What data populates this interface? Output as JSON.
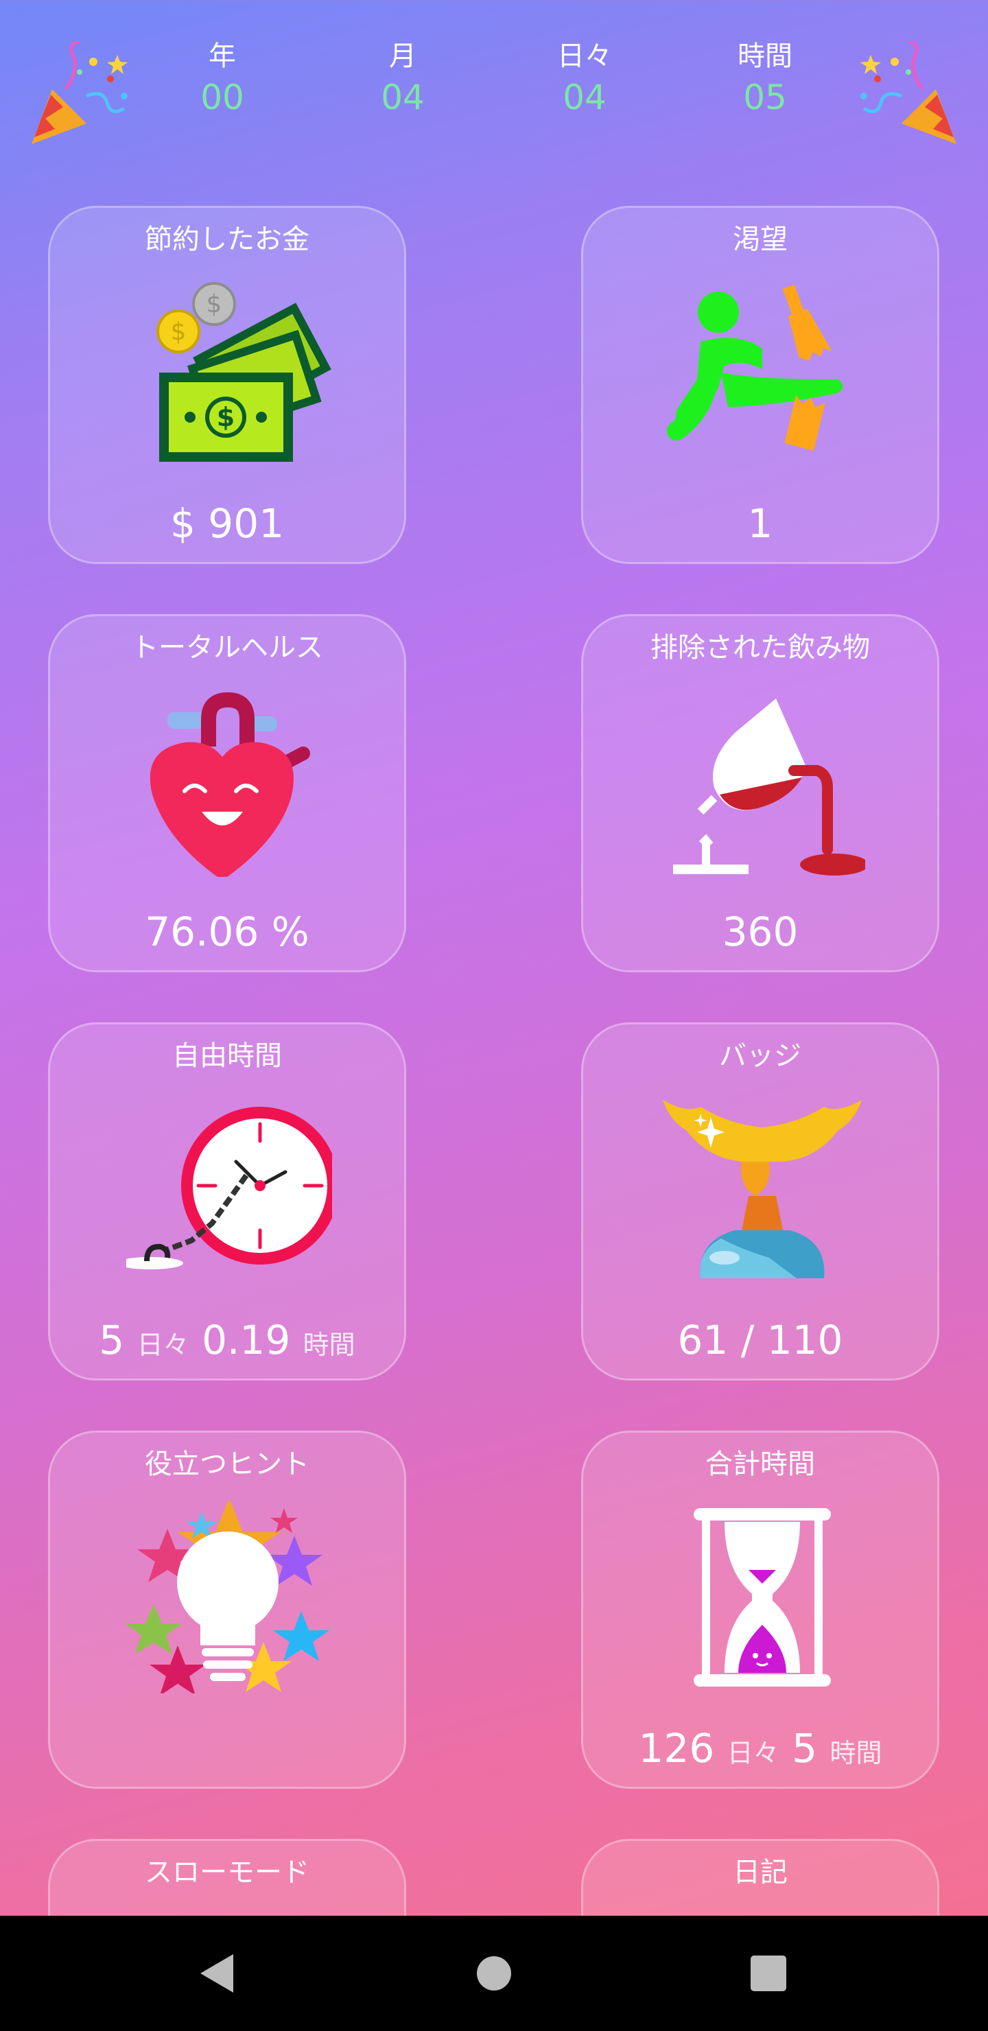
{
  "header": {
    "counters": [
      {
        "label": "年",
        "value": "00"
      },
      {
        "label": "月",
        "value": "04"
      },
      {
        "label": "日々",
        "value": "04"
      },
      {
        "label": "時間",
        "value": "05"
      }
    ],
    "icons": {
      "left": "party-popper-icon",
      "right": "party-popper-icon"
    },
    "value_color": "#7ce7a4"
  },
  "cards": {
    "money": {
      "title": "節約したお金",
      "value": "$ 901",
      "icon": "money-stack-icon"
    },
    "craving": {
      "title": "渇望",
      "value": "1",
      "icon": "kick-bottle-icon"
    },
    "health": {
      "title": "トータルヘルス",
      "value": "76.06 %",
      "icon": "happy-heart-icon"
    },
    "drinks": {
      "title": "排除された飲み物",
      "value": "360",
      "icon": "spilled-wine-icon"
    },
    "freetime": {
      "title": "自由時間",
      "num1": "5",
      "unit1": "日々",
      "num2": "0.19",
      "unit2": "時間",
      "icon": "chained-clock-icon"
    },
    "badges": {
      "title": "バッジ",
      "value": "61 / 110",
      "icon": "trophy-icon"
    },
    "tips": {
      "title": "役立つヒント",
      "icon": "lightbulb-stars-icon"
    },
    "totaltime": {
      "title": "合計時間",
      "num1": "126",
      "unit1": "日々",
      "num2": "5",
      "unit2": "時間",
      "icon": "hourglass-icon"
    },
    "slowmode": {
      "title": "スローモード"
    },
    "diary": {
      "title": "日記"
    }
  },
  "colors": {
    "background_top": "#7388f7",
    "background_bottom": "#f8708a",
    "navbar": "#000000"
  },
  "navbar": {
    "icons": [
      "back-triangle-icon",
      "home-circle-icon",
      "recents-square-icon"
    ]
  }
}
